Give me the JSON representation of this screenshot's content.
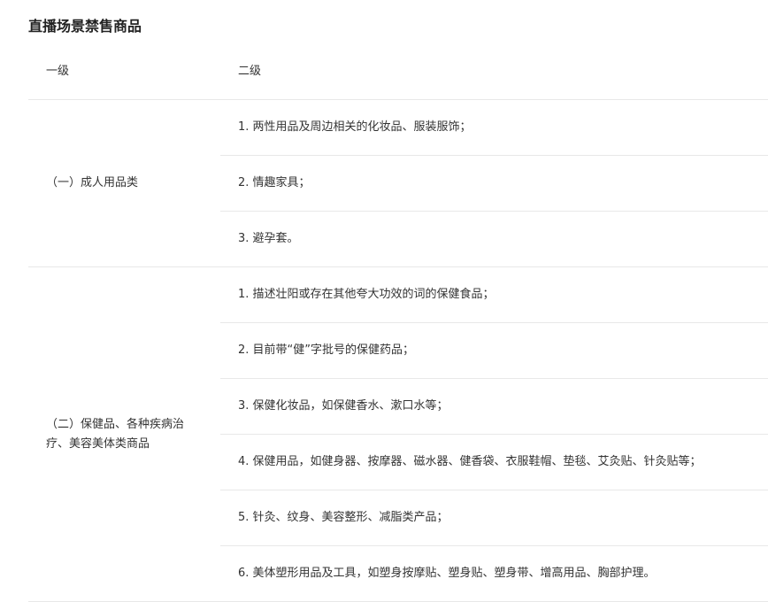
{
  "title": "直播场景禁售商品",
  "table": {
    "headers": [
      "一级",
      "二级"
    ],
    "groups": [
      {
        "label": "（一）成人用品类",
        "items": [
          "1. 两性用品及周边相关的化妆品、服装服饰；",
          "2. 情趣家具；",
          "3. 避孕套。"
        ]
      },
      {
        "label": "（二）保健品、各种疾病治疗、美容美体类商品",
        "items": [
          "1. 描述壮阳或存在其他夸大功效的词的保健食品；",
          "2. 目前带“健”字批号的保健药品；",
          "3. 保健化妆品，如保健香水、漱口水等；",
          "4. 保健用品，如健身器、按摩器、磁水器、健香袋、衣服鞋帽、垫毯、艾灸贴、针灸贴等；",
          "5. 针灸、纹身、美容整形、减脂类产品；",
          "6. 美体塑形用品及工具，如塑身按摩贴、塑身贴、塑身带、增高用品、胸部护理。"
        ]
      }
    ]
  }
}
